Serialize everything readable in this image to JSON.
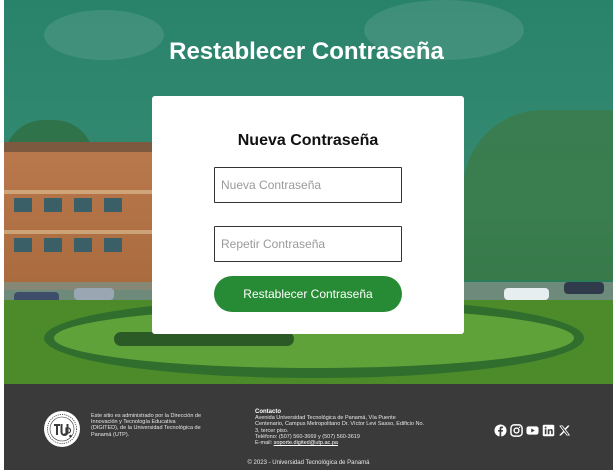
{
  "page": {
    "title": "Restablecer Contraseña"
  },
  "card": {
    "title": "Nueva Contraseña",
    "new_password_placeholder": "Nueva Contraseña",
    "repeat_password_placeholder": "Repetir Contraseña",
    "submit_label": "Restablecer Contraseña"
  },
  "footer": {
    "admin_text": "Este sitio es administrado por la Dirección de Innovación y Tecnología Educativa (DIGITED), de la Universidad Tecnológica de Panamá (UTP).",
    "contact_title": "Contacto",
    "contact_lines": [
      "Avenida Universidad Tecnológica de Panamá, Vía Puente Centenario, Campus Metropolitano Dr. Víctor Levi Sasso, Edificio No. 3, tercer piso.",
      "Teléfono: (507) 560-3669 y (507) 560-3619"
    ],
    "email_label": "E-mail:",
    "email": "soporte.digited@utp.ac.pa",
    "copyright": "© 2023 - Universidad Tecnológica de Panamá",
    "social_icons": [
      "facebook-icon",
      "instagram-icon",
      "youtube-icon",
      "linkedin-icon",
      "x-icon"
    ]
  },
  "colors": {
    "accent": "#268b34",
    "footer_bg": "#3a3a3a",
    "hero_overlay": "#19785f"
  }
}
